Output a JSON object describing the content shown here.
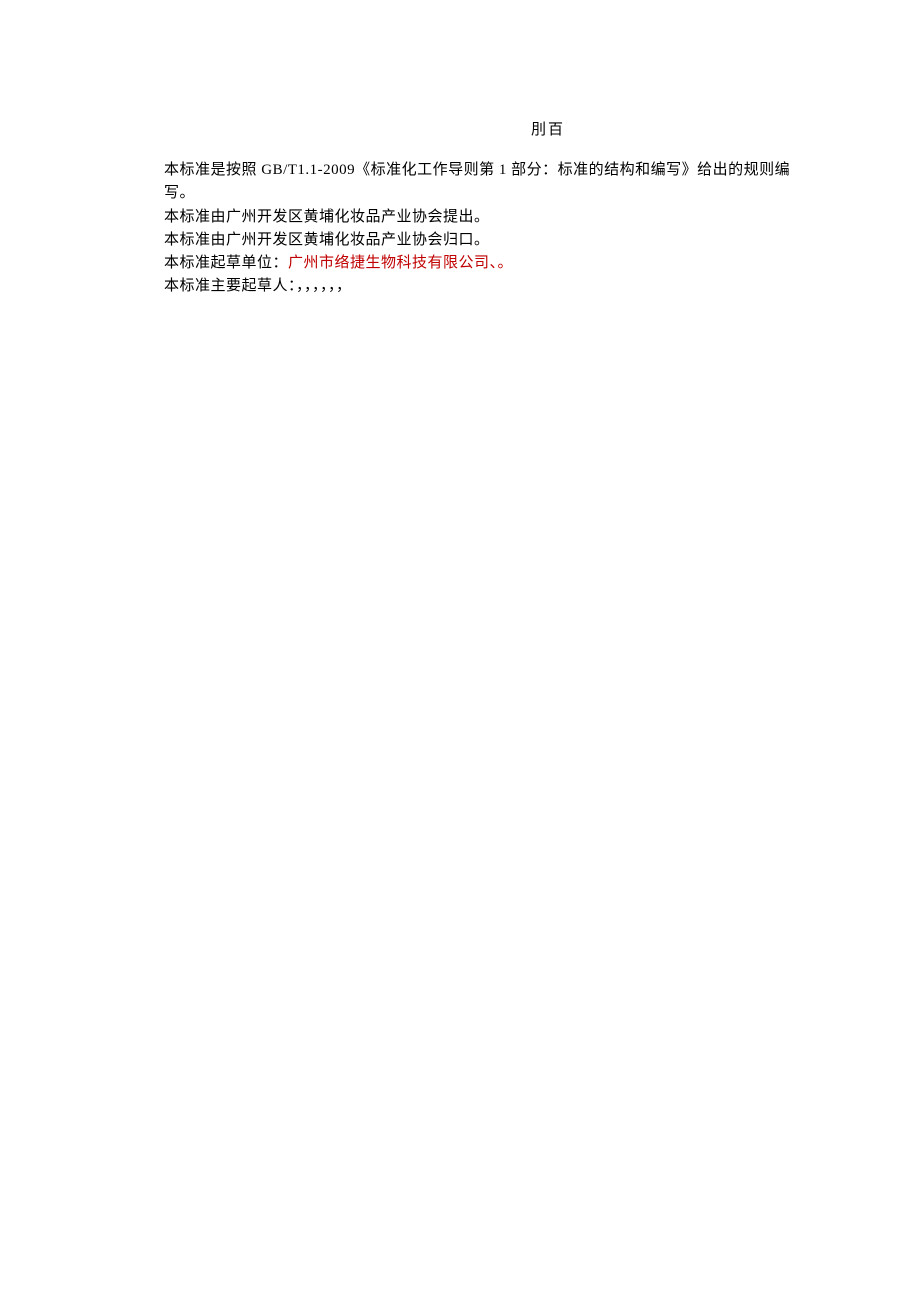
{
  "doc": {
    "title": "刖百",
    "paragraphs": {
      "p1": "本标准是按照 GB/T1.1-2009《标准化工作导则第 1 部分：标准的结构和编写》给出的规则编写。",
      "p2": "本标准由广州开发区黄埔化妆品产业协会提出。",
      "p3": "本标准由广州开发区黄埔化妆品产业协会归口。",
      "p4_prefix": "本标准起草单位：",
      "p4_highlight": "广州市络捷生物科技有限公司、。",
      "p5": "本标准主要起草人：，，，，，，"
    }
  }
}
